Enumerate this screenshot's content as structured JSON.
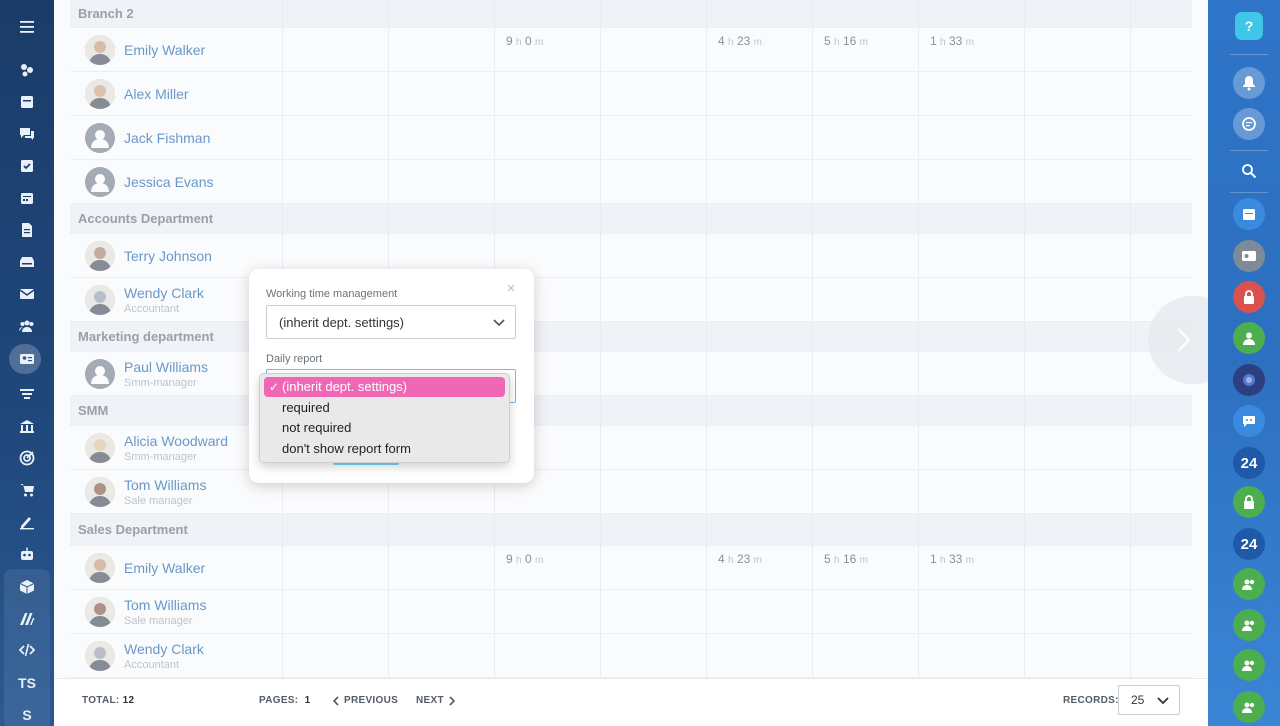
{
  "sidebar_left": {
    "items": [
      {
        "icon": "menu-icon"
      },
      {
        "icon": "activity-stream-icon"
      },
      {
        "icon": "feed-icon"
      },
      {
        "icon": "chat-icon"
      },
      {
        "icon": "tasks-icon"
      },
      {
        "icon": "calendar-icon"
      },
      {
        "icon": "documents-icon"
      },
      {
        "icon": "drive-icon"
      },
      {
        "icon": "mail-icon"
      },
      {
        "icon": "groups-icon"
      },
      {
        "icon": "employees-icon"
      },
      {
        "icon": "filter-icon"
      },
      {
        "icon": "company-icon"
      },
      {
        "icon": "target-icon"
      },
      {
        "icon": "cart-icon"
      },
      {
        "icon": "signature-icon"
      },
      {
        "icon": "robot-icon"
      },
      {
        "icon": "box-icon"
      },
      {
        "icon": "market-icon"
      },
      {
        "icon": "code-icon"
      }
    ],
    "text_items": [
      "TS",
      "S"
    ]
  },
  "groups": [
    {
      "label": "Branch 2"
    },
    {
      "label": "Accounts Department"
    },
    {
      "label": "Marketing department"
    },
    {
      "label": "SMM"
    },
    {
      "label": "Sales Department"
    }
  ],
  "employees": [
    {
      "name": "Emily Walker",
      "position": "",
      "times": [
        [
          "9",
          "h",
          "0",
          "m"
        ],
        [
          "4",
          "h",
          "23",
          "m"
        ],
        [
          "5",
          "h",
          "16",
          "m"
        ],
        [
          "1",
          "h",
          "33",
          "m"
        ]
      ]
    },
    {
      "name": "Alex Miller",
      "position": ""
    },
    {
      "name": "Jack Fishman",
      "position": ""
    },
    {
      "name": "Jessica Evans",
      "position": ""
    },
    {
      "name": "Terry Johnson",
      "position": ""
    },
    {
      "name": "Wendy Clark",
      "position": "Accountant"
    },
    {
      "name": "Paul Williams",
      "position": "Smm-manager"
    },
    {
      "name": "Alicia Woodward",
      "position": "Smm-manager"
    },
    {
      "name": "Tom Williams",
      "position": "Sale manager"
    },
    {
      "name": "Emily Walker",
      "position": "",
      "times": [
        [
          "9",
          "h",
          "0",
          "m"
        ],
        [
          "4",
          "h",
          "23",
          "m"
        ],
        [
          "5",
          "h",
          "16",
          "m"
        ],
        [
          "1",
          "h",
          "33",
          "m"
        ]
      ]
    },
    {
      "name": "Tom Williams",
      "position": "Sale manager"
    },
    {
      "name": "Wendy Clark",
      "position": "Accountant"
    }
  ],
  "popup": {
    "close_label": "×",
    "working_time_label": "Working time management",
    "working_time_value": "(inherit dept. settings)",
    "daily_report_label": "Daily report"
  },
  "dropdown": {
    "options": [
      "(inherit dept. settings)",
      "required",
      "not required",
      "don't show report form"
    ],
    "selected": "(inherit dept. settings)",
    "check": "✓"
  },
  "footer": {
    "total_label": "TOTAL:",
    "total_value": "12",
    "pages_label": "PAGES:",
    "pages_value": "1",
    "previous_label": "PREVIOUS",
    "next_label": "NEXT",
    "records_label": "RECORDS:",
    "records_value": "25"
  },
  "sidebar_right": {
    "help_label": "?",
    "badge_label": "24",
    "colors": {
      "accent": "#3fc6e8",
      "lock_red": "#d9524f",
      "green": "#4cae4f",
      "dark_blue": "#1e5aa8"
    }
  },
  "colors": {
    "link": "#2067b0",
    "selected_option": "#f067b5"
  }
}
